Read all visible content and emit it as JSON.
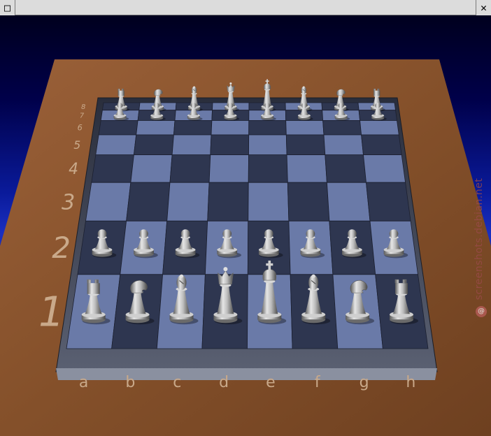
{
  "window": {
    "menu_glyph": "□",
    "close_glyph": "✕"
  },
  "board": {
    "files": [
      "a",
      "b",
      "c",
      "d",
      "e",
      "f",
      "g",
      "h"
    ],
    "ranks": [
      "1",
      "2",
      "3",
      "4",
      "5",
      "6",
      "7",
      "8"
    ],
    "light_square_color": "#6a7aa8",
    "dark_square_color": "#2e3650",
    "table_color": "#8a5530",
    "piece_color": "#bfbfbf",
    "pieces": [
      {
        "type": "rook",
        "square": "a8"
      },
      {
        "type": "knight",
        "square": "b8"
      },
      {
        "type": "bishop",
        "square": "c8"
      },
      {
        "type": "queen",
        "square": "d8"
      },
      {
        "type": "king",
        "square": "e8"
      },
      {
        "type": "bishop",
        "square": "f8"
      },
      {
        "type": "knight",
        "square": "g8"
      },
      {
        "type": "rook",
        "square": "h8"
      },
      {
        "type": "pawn",
        "square": "a7"
      },
      {
        "type": "pawn",
        "square": "b7"
      },
      {
        "type": "pawn",
        "square": "c7"
      },
      {
        "type": "pawn",
        "square": "d7"
      },
      {
        "type": "pawn",
        "square": "e7"
      },
      {
        "type": "pawn",
        "square": "f7"
      },
      {
        "type": "pawn",
        "square": "g7"
      },
      {
        "type": "pawn",
        "square": "h7"
      },
      {
        "type": "pawn",
        "square": "a2"
      },
      {
        "type": "pawn",
        "square": "b2"
      },
      {
        "type": "pawn",
        "square": "c2"
      },
      {
        "type": "pawn",
        "square": "d2"
      },
      {
        "type": "pawn",
        "square": "e2"
      },
      {
        "type": "pawn",
        "square": "f2"
      },
      {
        "type": "pawn",
        "square": "g2"
      },
      {
        "type": "pawn",
        "square": "h2"
      },
      {
        "type": "rook",
        "square": "a1"
      },
      {
        "type": "knight",
        "square": "b1"
      },
      {
        "type": "bishop",
        "square": "c1"
      },
      {
        "type": "queen",
        "square": "d1"
      },
      {
        "type": "king",
        "square": "e1"
      },
      {
        "type": "bishop",
        "square": "f1"
      },
      {
        "type": "knight",
        "square": "g1"
      },
      {
        "type": "rook",
        "square": "h1"
      }
    ]
  },
  "watermark": {
    "text": "screenshots.debian.net"
  }
}
